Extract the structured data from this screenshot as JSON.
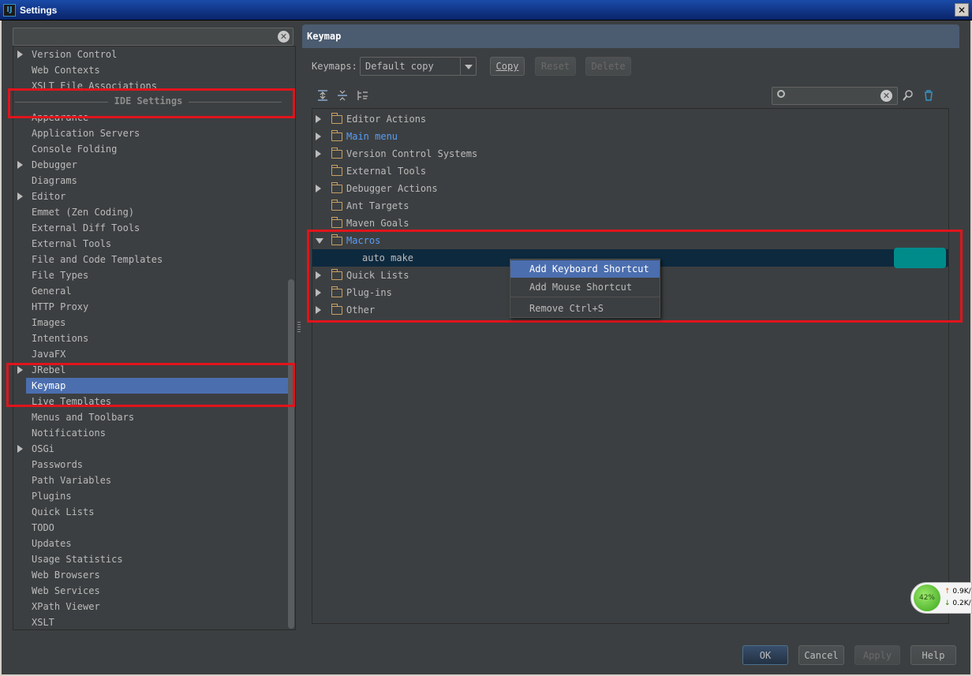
{
  "window": {
    "title": "Settings",
    "icon_text": "IJ"
  },
  "left": {
    "search_value": "",
    "items": [
      {
        "label": "Version Control",
        "arrow": true
      },
      {
        "label": "Web Contexts",
        "arrow": false
      },
      {
        "label": "XSLT File Associations",
        "arrow": false
      },
      {
        "label": "Appearance",
        "arrow": false
      },
      {
        "label": "Application Servers",
        "arrow": false
      },
      {
        "label": "Console Folding",
        "arrow": false
      },
      {
        "label": "Debugger",
        "arrow": true
      },
      {
        "label": "Diagrams",
        "arrow": false
      },
      {
        "label": "Editor",
        "arrow": true
      },
      {
        "label": "Emmet (Zen Coding)",
        "arrow": false
      },
      {
        "label": "External Diff Tools",
        "arrow": false
      },
      {
        "label": "External Tools",
        "arrow": false
      },
      {
        "label": "File and Code Templates",
        "arrow": false
      },
      {
        "label": "File Types",
        "arrow": false
      },
      {
        "label": "General",
        "arrow": false
      },
      {
        "label": "HTTP Proxy",
        "arrow": false
      },
      {
        "label": "Images",
        "arrow": false
      },
      {
        "label": "Intentions",
        "arrow": false
      },
      {
        "label": "JavaFX",
        "arrow": false
      },
      {
        "label": "JRebel",
        "arrow": true
      },
      {
        "label": "Keymap",
        "arrow": false
      },
      {
        "label": "Live Templates",
        "arrow": false
      },
      {
        "label": "Menus and Toolbars",
        "arrow": false
      },
      {
        "label": "Notifications",
        "arrow": false
      },
      {
        "label": "OSGi",
        "arrow": true
      },
      {
        "label": "Passwords",
        "arrow": false
      },
      {
        "label": "Path Variables",
        "arrow": false
      },
      {
        "label": "Plugins",
        "arrow": false
      },
      {
        "label": "Quick Lists",
        "arrow": false
      },
      {
        "label": "TODO",
        "arrow": false
      },
      {
        "label": "Updates",
        "arrow": false
      },
      {
        "label": "Usage Statistics",
        "arrow": false
      },
      {
        "label": "Web Browsers",
        "arrow": false
      },
      {
        "label": "Web Services",
        "arrow": false
      },
      {
        "label": "XPath Viewer",
        "arrow": false
      },
      {
        "label": "XSLT",
        "arrow": false
      }
    ],
    "section_label": "IDE Settings",
    "selected": "Keymap"
  },
  "keymap": {
    "header": "Keymap",
    "keymaps_label": "Keymaps:",
    "keymap_value": "Default copy",
    "copy_label": "Copy",
    "reset_label": "Reset",
    "delete_label": "Delete",
    "search_value": "",
    "tree": [
      {
        "label": "Editor Actions",
        "arrow": "right",
        "blue": false
      },
      {
        "label": "Main menu",
        "arrow": "right",
        "blue": true
      },
      {
        "label": "Version Control Systems",
        "arrow": "right",
        "blue": false
      },
      {
        "label": "External Tools",
        "arrow": "none",
        "blue": false
      },
      {
        "label": "Debugger Actions",
        "arrow": "right",
        "blue": false
      },
      {
        "label": "Ant Targets",
        "arrow": "none",
        "blue": false
      },
      {
        "label": "Maven Goals",
        "arrow": "none",
        "blue": false
      },
      {
        "label": "Macros",
        "arrow": "down",
        "blue": true
      },
      {
        "label": "auto make",
        "arrow": "child",
        "blue": false
      },
      {
        "label": "Quick Lists",
        "arrow": "right",
        "blue": false
      },
      {
        "label": "Plug-ins",
        "arrow": "right",
        "blue": false
      },
      {
        "label": "Other",
        "arrow": "right",
        "blue": false
      }
    ]
  },
  "context_menu": {
    "items": [
      "Add Keyboard Shortcut",
      "Add Mouse Shortcut",
      "Remove Ctrl+S"
    ]
  },
  "footer": {
    "ok": "OK",
    "cancel": "Cancel",
    "apply": "Apply",
    "help": "Help"
  },
  "netmeter": {
    "percent": "42%",
    "up": "0.9K/",
    "down": "0.2K/"
  },
  "colors": {
    "accent": "#4b6eaf",
    "highlight_box": "#e0141c",
    "macro_shortcut": "#008b8b"
  }
}
